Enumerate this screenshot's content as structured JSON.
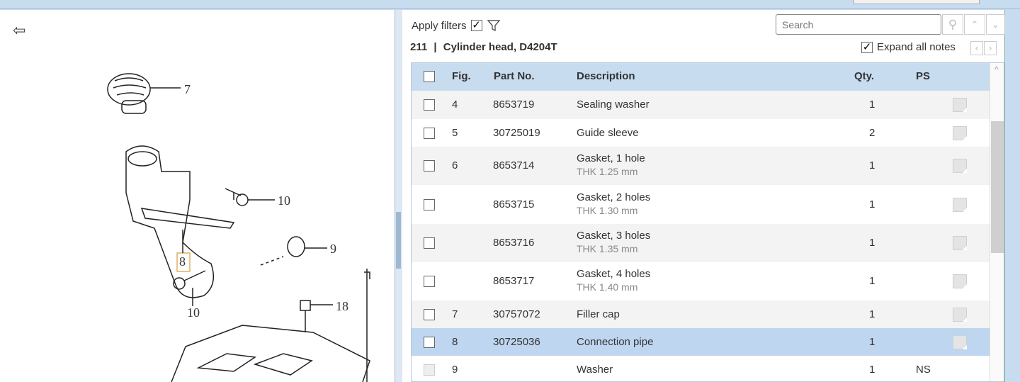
{
  "toolbar": {
    "apply_filters": "Apply filters",
    "apply_filters_checked": true,
    "search_placeholder": "Search",
    "expand_all_notes": "Expand all notes",
    "expand_checked": true
  },
  "title": {
    "number": "211",
    "separator": "|",
    "name": "Cylinder head, D4204T"
  },
  "table": {
    "headers": {
      "fig": "Fig.",
      "part": "Part No.",
      "desc": "Description",
      "qty": "Qty.",
      "ps": "PS"
    },
    "rows": [
      {
        "fig": "4",
        "part": "8653719",
        "desc": "Sealing washer",
        "sub": "",
        "qty": "1",
        "ps": ""
      },
      {
        "fig": "5",
        "part": "30725019",
        "desc": "Guide sleeve",
        "sub": "",
        "qty": "2",
        "ps": ""
      },
      {
        "fig": "6",
        "part": "8653714",
        "desc": "Gasket, 1 hole",
        "sub": "THK 1.25 mm",
        "qty": "1",
        "ps": ""
      },
      {
        "fig": "",
        "part": "8653715",
        "desc": "Gasket, 2 holes",
        "sub": "THK 1.30 mm",
        "qty": "1",
        "ps": ""
      },
      {
        "fig": "",
        "part": "8653716",
        "desc": "Gasket, 3 holes",
        "sub": "THK 1.35 mm",
        "qty": "1",
        "ps": ""
      },
      {
        "fig": "",
        "part": "8653717",
        "desc": "Gasket, 4 holes",
        "sub": "THK 1.40 mm",
        "qty": "1",
        "ps": ""
      },
      {
        "fig": "7",
        "part": "30757072",
        "desc": "Filler cap",
        "sub": "",
        "qty": "1",
        "ps": ""
      },
      {
        "fig": "8",
        "part": "30725036",
        "desc": "Connection pipe",
        "sub": "",
        "qty": "1",
        "ps": ""
      },
      {
        "fig": "9",
        "part": "",
        "desc": "Washer",
        "sub": "",
        "qty": "1",
        "ps": "NS"
      }
    ]
  },
  "diagram": {
    "callouts": [
      "7",
      "10",
      "9",
      "8",
      "10",
      "18"
    ]
  }
}
